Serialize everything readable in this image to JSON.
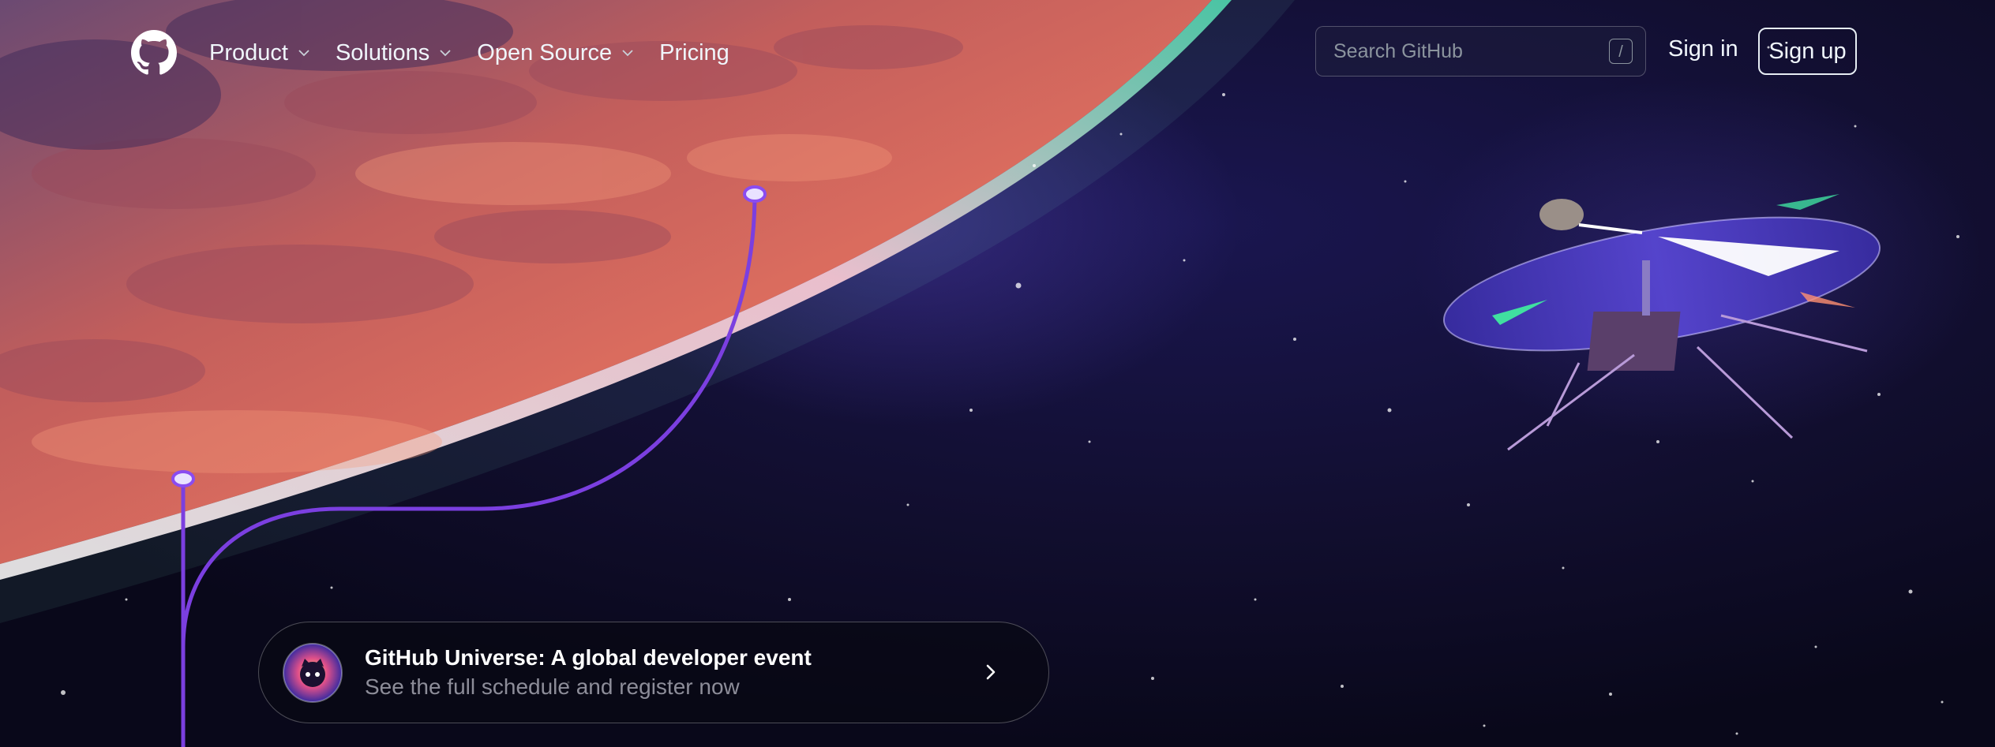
{
  "header": {
    "logo_icon": "github-mark-icon",
    "nav": [
      {
        "label": "Product",
        "has_dropdown": true
      },
      {
        "label": "Solutions",
        "has_dropdown": true
      },
      {
        "label": "Open Source",
        "has_dropdown": true
      },
      {
        "label": "Pricing",
        "has_dropdown": false
      }
    ],
    "search": {
      "placeholder": "Search GitHub",
      "shortcut": "/"
    },
    "sign_in": "Sign in",
    "sign_up": "Sign up"
  },
  "banner": {
    "title": "GitHub Universe: A global developer event",
    "subtitle": "See the full schedule and register now",
    "icon": "universe-octocat-icon",
    "arrow_icon": "chevron-right-icon"
  },
  "hero": {
    "illustration": "mars-planet-and-helicopter"
  },
  "colors": {
    "background": "#0d0b24",
    "planet": "#e4715c",
    "line_accent": "#7c3aed",
    "text": "#f0f6fc"
  }
}
